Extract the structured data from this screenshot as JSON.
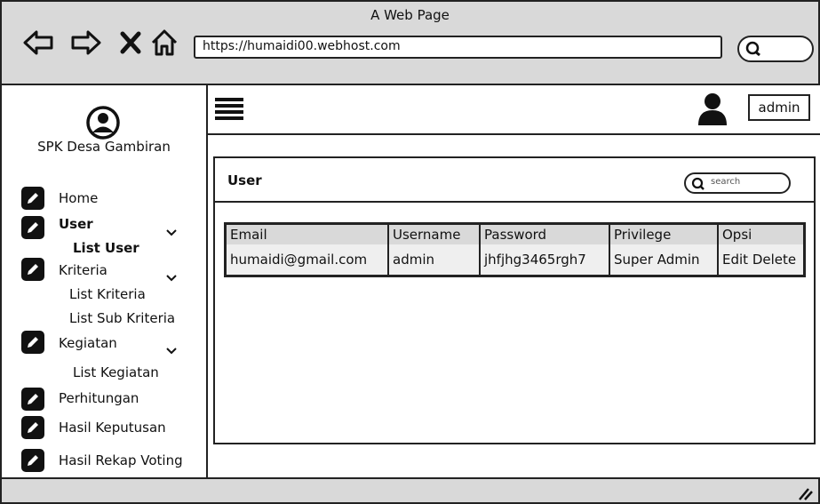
{
  "window": {
    "title": "A Web Page"
  },
  "browser": {
    "url": "https://humaidi00.webhost.com",
    "nav_icons": [
      "back-arrow-icon",
      "forward-arrow-icon",
      "close-icon",
      "home-icon"
    ],
    "search_icon": "search-icon"
  },
  "sidebar": {
    "brand_icon": "user-circle-icon",
    "brand_name": "SPK Desa Gambiran",
    "items": [
      {
        "label": "Home",
        "icon": "edit-icon",
        "bold": false
      },
      {
        "label": "User",
        "icon": "edit-icon",
        "bold": true,
        "expandable": true,
        "children": [
          {
            "label": "List User",
            "bold": true
          }
        ]
      },
      {
        "label": "Kriteria",
        "icon": "edit-icon",
        "bold": false,
        "expandable": true,
        "children": [
          {
            "label": "List Kriteria"
          },
          {
            "label": "List Sub Kriteria"
          }
        ]
      },
      {
        "label": "Kegiatan",
        "icon": "edit-icon",
        "bold": false,
        "expandable": true,
        "children": [
          {
            "label": "List Kegiatan"
          }
        ]
      },
      {
        "label": "Perhitungan",
        "icon": "edit-icon",
        "bold": false
      },
      {
        "label": "Hasil Keputusan",
        "icon": "edit-icon",
        "bold": false
      },
      {
        "label": "Hasil Rekap Voting",
        "icon": "edit-icon",
        "bold": false
      }
    ]
  },
  "topbar": {
    "menu_icon": "hamburger-menu-icon",
    "user_icon": "user-icon",
    "user_label": "admin"
  },
  "panel": {
    "title": "User",
    "search_placeholder": "search",
    "table": {
      "columns": [
        "Email",
        "Username",
        "Password",
        "Privilege",
        "Opsi"
      ],
      "rows": [
        [
          "humaidi@gmail.com",
          "admin",
          "jhfjhg3465rgh7",
          "Super Admin",
          "Edit Delete"
        ]
      ]
    }
  },
  "colors": {
    "chrome": "#d9d9d9",
    "border": "#222222",
    "row_bg": "#efefef"
  }
}
